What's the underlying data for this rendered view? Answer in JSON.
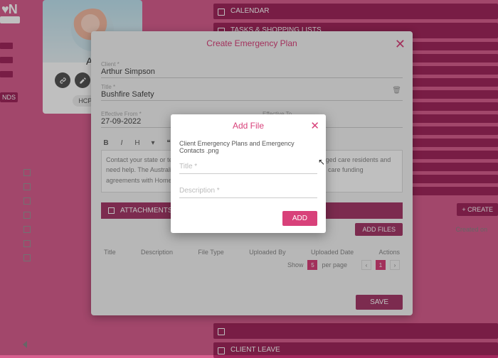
{
  "brand": "♥N",
  "sidebar": {
    "ndis": "NDS"
  },
  "profile": {
    "name": "Art",
    "badge": "HCP - 1.3"
  },
  "panels": {
    "calendar": "CALENDAR",
    "tasks": "TASKS & SHOPPING LISTS",
    "leave": "CLIENT LEAVE"
  },
  "createBtn": "+ CREATE",
  "createdOn": "Created on",
  "modal": {
    "title": "Create Emergency Plan",
    "clientLbl": "Client *",
    "client": "Arthur Simpson",
    "titleLbl": "Title *",
    "titleVal": "Bushfire Safety",
    "fromLbl": "Effective From *",
    "from": "27-09-2022",
    "toLbl": "Effective To",
    "body": "Contact your state or territory government if you need to relocate residential aged care residents and need help. The Australian Government has obligations under its grant or aged care funding agreements with Home Care Package providers.**",
    "attachments": "ATTACHMENTS",
    "addFiles": "ADD FILES",
    "cols": {
      "c1": "Title",
      "c2": "Description",
      "c3": "File Type",
      "c4": "Uploaded By",
      "c5": "Uploaded Date",
      "c6": "Actions"
    },
    "pager": {
      "show": "Show",
      "count": "5",
      "per": "per page",
      "page": "1",
      "prev": "‹",
      "next": "›"
    },
    "save": "SAVE"
  },
  "dialog": {
    "title": "Add File",
    "filename": "Client Emergency Plans and Emergency Contacts .png",
    "titlePh": "Title *",
    "descPh": "Description *",
    "add": "ADD"
  }
}
